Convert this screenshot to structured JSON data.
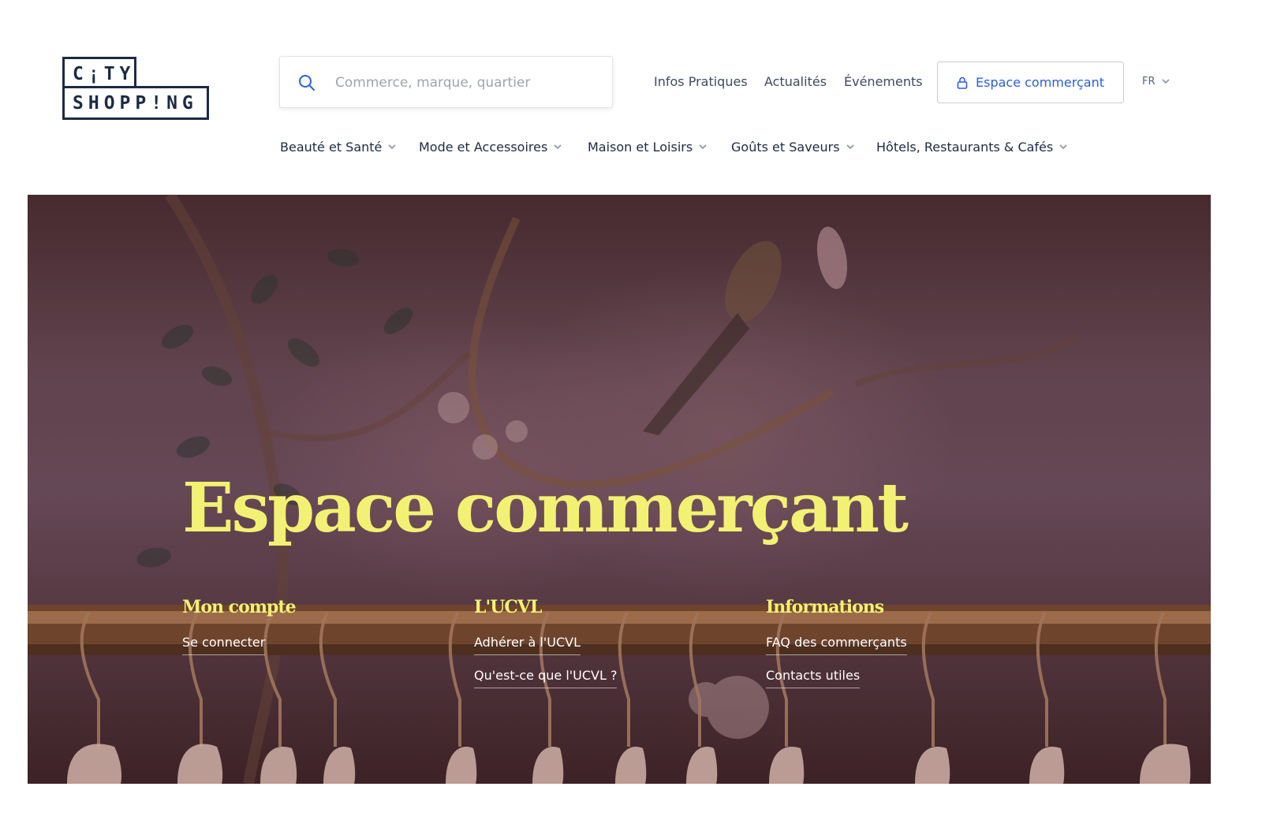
{
  "logo": {
    "line1": "C¡TY",
    "line2": "SHOPP!NG"
  },
  "search": {
    "placeholder": "Commerce, marque, quartier"
  },
  "topnav": {
    "links": [
      "Infos Pratiques",
      "Actualités",
      "Événements"
    ],
    "merchant_button": "Espace commerçant",
    "language": "FR"
  },
  "categories": [
    "Beauté et Santé",
    "Mode et Accessoires",
    "Maison et Loisirs",
    "Goûts et Saveurs",
    "Hôtels, Restaurants & Cafés"
  ],
  "hero": {
    "title": "Espace commerçant",
    "columns": [
      {
        "heading": "Mon compte",
        "links": [
          "Se connecter"
        ]
      },
      {
        "heading": "L'UCVL",
        "links": [
          "Adhérer à l'UCVL",
          "Qu'est-ce que l'UCVL ?"
        ]
      },
      {
        "heading": "Informations",
        "links": [
          "FAQ des commerçants",
          "Contacts utiles"
        ]
      }
    ]
  },
  "colors": {
    "brand_navy": "#1c2a44",
    "link_blue": "#2b5fd9",
    "hero_yellow": "#f3f173"
  },
  "icons": [
    "search-icon",
    "lock-icon",
    "chevron-down-icon"
  ]
}
